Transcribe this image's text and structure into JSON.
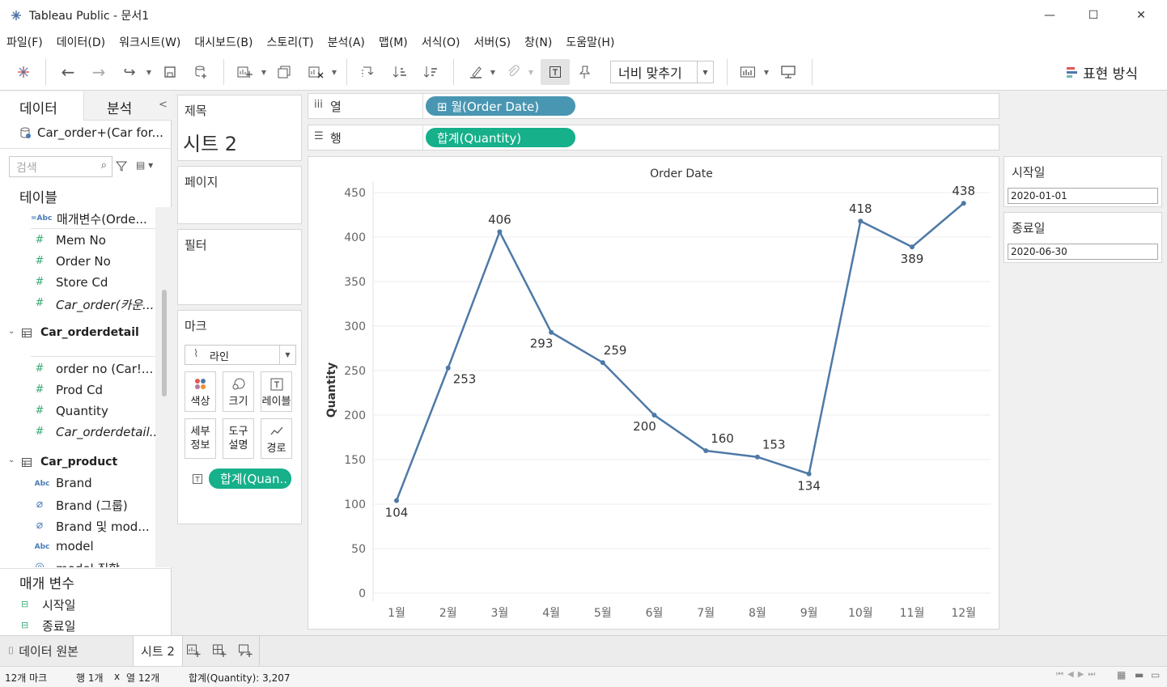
{
  "window": {
    "title": "Tableau Public - 문서1",
    "minimize_glyph": "—",
    "maximize_glyph": "☐",
    "close_glyph": "✕"
  },
  "menu": [
    "파일(F)",
    "데이터(D)",
    "워크시트(W)",
    "대시보드(B)",
    "스토리(T)",
    "분석(A)",
    "맵(M)",
    "서식(O)",
    "서버(S)",
    "창(N)",
    "도움말(H)"
  ],
  "toolbar": {
    "fit_label": "너비 맞추기",
    "show_me_label": "표현 방식"
  },
  "data_pane": {
    "tab_data": "데이터",
    "tab_analysis": "분석",
    "datasource": "Car_order+(Car for...",
    "search_placeholder": "검색",
    "tables_label": "테이블",
    "fields_top": [
      {
        "icon": "=Abc",
        "name": "매개변수(Orde...",
        "italic": false
      },
      {
        "icon": "#",
        "name": "Mem No",
        "italic": false
      },
      {
        "icon": "#",
        "name": "Order No",
        "italic": false
      },
      {
        "icon": "#",
        "name": "Store Cd",
        "italic": false
      },
      {
        "icon": "#",
        "name": "Car_order(카운...",
        "italic": true
      }
    ],
    "table2": "Car_orderdetail",
    "fields_mid": [
      {
        "icon": "#",
        "name": "order no (Car!...",
        "italic": false
      },
      {
        "icon": "#",
        "name": "Prod Cd",
        "italic": false
      },
      {
        "icon": "#",
        "name": "Quantity",
        "italic": false
      },
      {
        "icon": "#",
        "name": "Car_orderdetail...",
        "italic": true
      }
    ],
    "table3": "Car_product",
    "fields_bottom": [
      {
        "icon": "Abc",
        "name": "Brand",
        "italic": false
      },
      {
        "icon": "clip",
        "name": "Brand (그룹)",
        "italic": false
      },
      {
        "icon": "clip",
        "name": "Brand 및 mod...",
        "italic": false
      },
      {
        "icon": "Abc",
        "name": "model",
        "italic": false
      },
      {
        "icon": "geo",
        "name": "model 집합",
        "italic": false
      }
    ],
    "params_label": "매개 변수",
    "params": [
      "시작일",
      "종료일"
    ]
  },
  "cards": {
    "title_label": "제목",
    "sheet_title": "시트 2",
    "pages_label": "페이지",
    "filters_label": "필터",
    "marks_label": "마크",
    "mark_type": "라인",
    "mark_buttons": [
      {
        "label": "색상",
        "icon": "color-icon"
      },
      {
        "label": "크기",
        "icon": "size-icon"
      },
      {
        "label": "레이블",
        "icon": "label-icon"
      },
      {
        "label": "세부\n정보",
        "icon": "detail-icon"
      },
      {
        "label": "도구\n설명",
        "icon": "tooltip-icon"
      },
      {
        "label": "경로",
        "icon": "path-icon"
      }
    ],
    "mark_pill": "합계(Quan.."
  },
  "shelves": {
    "columns_label": "열",
    "columns_pill": "⊞ 월(Order Date)",
    "rows_label": "행",
    "rows_pill": "합계(Quantity)"
  },
  "filters": {
    "start_label": "시작일",
    "start_value": "2020-01-01",
    "end_label": "종료일",
    "end_value": "2020-06-30"
  },
  "chart_data": {
    "type": "line",
    "title": "Order Date",
    "ylabel": "Quantity",
    "xlabel": "",
    "categories": [
      "1월",
      "2월",
      "3월",
      "4월",
      "5월",
      "6월",
      "7월",
      "8월",
      "9월",
      "10월",
      "11월",
      "12월"
    ],
    "values": [
      104,
      253,
      406,
      293,
      259,
      200,
      160,
      153,
      134,
      418,
      389,
      438
    ],
    "ylim": [
      0,
      450
    ],
    "yticks": [
      0,
      50,
      100,
      150,
      200,
      250,
      300,
      350,
      400,
      450
    ],
    "grid": true,
    "line_color": "#4e79a7"
  },
  "sheet_tabs": {
    "datasource_tab": "데이터 원본",
    "active_tab": "시트 2"
  },
  "status": {
    "marks": "12개 마크",
    "rows": "행 1개",
    "times": "x",
    "cols": "열 12개",
    "sum": "합계(Quantity): 3,207"
  }
}
